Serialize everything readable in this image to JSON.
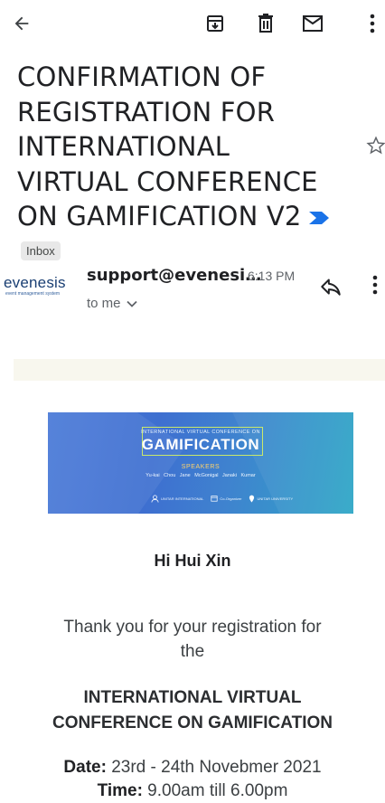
{
  "toolbar": {
    "back_icon": "arrow-left-icon",
    "archive_icon": "archive-icon",
    "delete_icon": "trash-icon",
    "mark_unread_icon": "envelope-icon",
    "more_icon": "more-vertical-icon"
  },
  "email": {
    "subject": "CONFIRMATION OF REGISTRATION FOR INTERNATIONAL VIRTUAL CONFERENCE ON GAMIFICATION V2",
    "label": "Inbox",
    "importance_color": "#1a73e8",
    "sender": "support@evenesi…",
    "time": "6:13 PM",
    "recipient": "to me",
    "sender_logo": {
      "brand": "evenesis",
      "tagline": "event management system"
    }
  },
  "banner": {
    "top_line": "INTERNATIONAL VIRTUAL CONFERENCE ON",
    "title": "GAMIFICATION",
    "speakers_heading": "SPEAKERS",
    "speakers": "Yu-kai Chou   Jane McGonigal   Janaki Kumar",
    "logo1": "UNITAR INTERNATIONAL",
    "logo2": "Co-Organizer",
    "logo3": "UNITAR UNIVERSITY"
  },
  "body": {
    "greeting": "Hi Hui Xin",
    "thanks": "Thank you for your registration for the",
    "event_name": "INTERNATIONAL VIRTUAL CONFERENCE ON GAMIFICATION",
    "date_label": "Date:",
    "date_value": " 23rd - 24th Novebmer 2021",
    "time_label": "Time:",
    "time_value": " 9.00am till 6.00pm"
  }
}
